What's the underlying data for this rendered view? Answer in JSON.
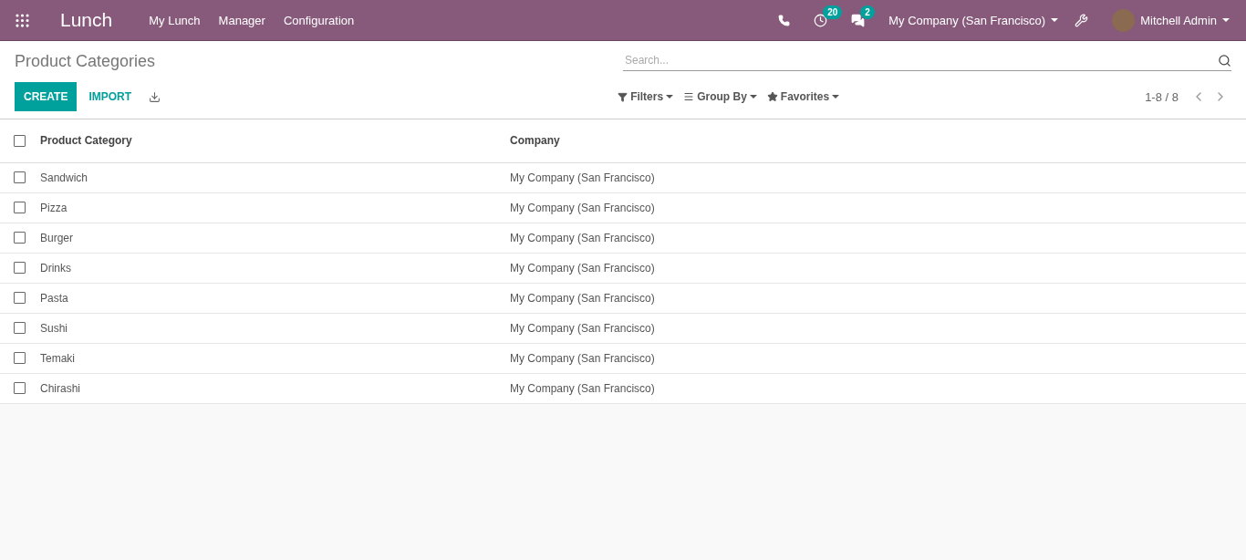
{
  "navbar": {
    "app_name": "Lunch",
    "menus": [
      "My Lunch",
      "Manager",
      "Configuration"
    ],
    "activity_count": "20",
    "message_count": "2",
    "company": "My Company (San Francisco)",
    "user": "Mitchell Admin"
  },
  "control_panel": {
    "title": "Product Categories",
    "search": {
      "placeholder": "Search..."
    },
    "create": "CREATE",
    "import": "IMPORT",
    "filters": "Filters",
    "group_by": "Group By",
    "favorites": "Favorites",
    "pager": "1-8 / 8"
  },
  "table": {
    "select_all_checked": false,
    "columns": [
      "Product Category",
      "Company"
    ],
    "rows": [
      {
        "cells": [
          "Sandwich",
          "My Company (San Francisco)"
        ],
        "checked": false
      },
      {
        "cells": [
          "Pizza",
          "My Company (San Francisco)"
        ],
        "checked": false
      },
      {
        "cells": [
          "Burger",
          "My Company (San Francisco)"
        ],
        "checked": false
      },
      {
        "cells": [
          "Drinks",
          "My Company (San Francisco)"
        ],
        "checked": false
      },
      {
        "cells": [
          "Pasta",
          "My Company (San Francisco)"
        ],
        "checked": false
      },
      {
        "cells": [
          "Sushi",
          "My Company (San Francisco)"
        ],
        "checked": false
      },
      {
        "cells": [
          "Temaki",
          "My Company (San Francisco)"
        ],
        "checked": false
      },
      {
        "cells": [
          "Chirashi",
          "My Company (San Francisco)"
        ],
        "checked": false
      }
    ]
  }
}
